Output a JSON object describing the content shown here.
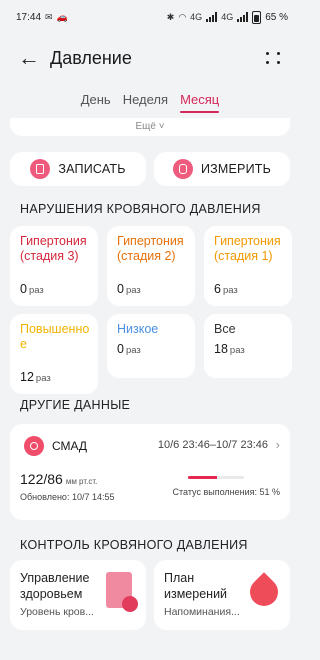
{
  "status": {
    "time": "17:44",
    "battery": "65 %",
    "net1": "4G",
    "net2": "4G"
  },
  "header": {
    "title": "Давление"
  },
  "tabs": [
    {
      "label": "День"
    },
    {
      "label": "Неделя"
    },
    {
      "label": "Месяц"
    }
  ],
  "more_label": "Ещё ˅",
  "actions": {
    "record": "ЗАПИСАТЬ",
    "measure": "ИЗМЕРИТЬ"
  },
  "violations": {
    "title": "НАРУШЕНИЯ КРОВЯНОГО ДАВЛЕНИЯ",
    "unit": "раз",
    "items": [
      {
        "name": "Гипертония (стадия 3)",
        "count": "0",
        "color": "#d4283c"
      },
      {
        "name": "Гипертония (стадия 2)",
        "count": "0",
        "color": "#e8710a"
      },
      {
        "name": "Гипертония (стадия 1)",
        "count": "6",
        "color": "#f29900"
      },
      {
        "name": "Повышенное",
        "count": "12",
        "color": "#f2b400"
      },
      {
        "name": "Низкое",
        "count": "0",
        "color": "#4a90e2"
      },
      {
        "name": "Все",
        "count": "18",
        "color": "#333333"
      }
    ]
  },
  "other": {
    "title": "ДРУГИЕ ДАННЫЕ",
    "smad": {
      "label": "СМАД",
      "range": "10/6 23:46–10/7 23:46",
      "value": "122/86",
      "unit": "мм рт.ст.",
      "updated": "Обновлено: 10/7 14:55",
      "status": "Статус выполнения: 51 %",
      "progress": 51
    }
  },
  "control": {
    "title": "КОНТРОЛЬ КРОВЯНОГО ДАВЛЕНИЯ",
    "cards": [
      {
        "title": "Управление здоровьем",
        "subtitle": "Уровень кров..."
      },
      {
        "title": "План измерений",
        "subtitle": "Напоминания..."
      }
    ]
  },
  "colors": {
    "accent": "#d4285a",
    "pink": "#ef5b7c"
  }
}
